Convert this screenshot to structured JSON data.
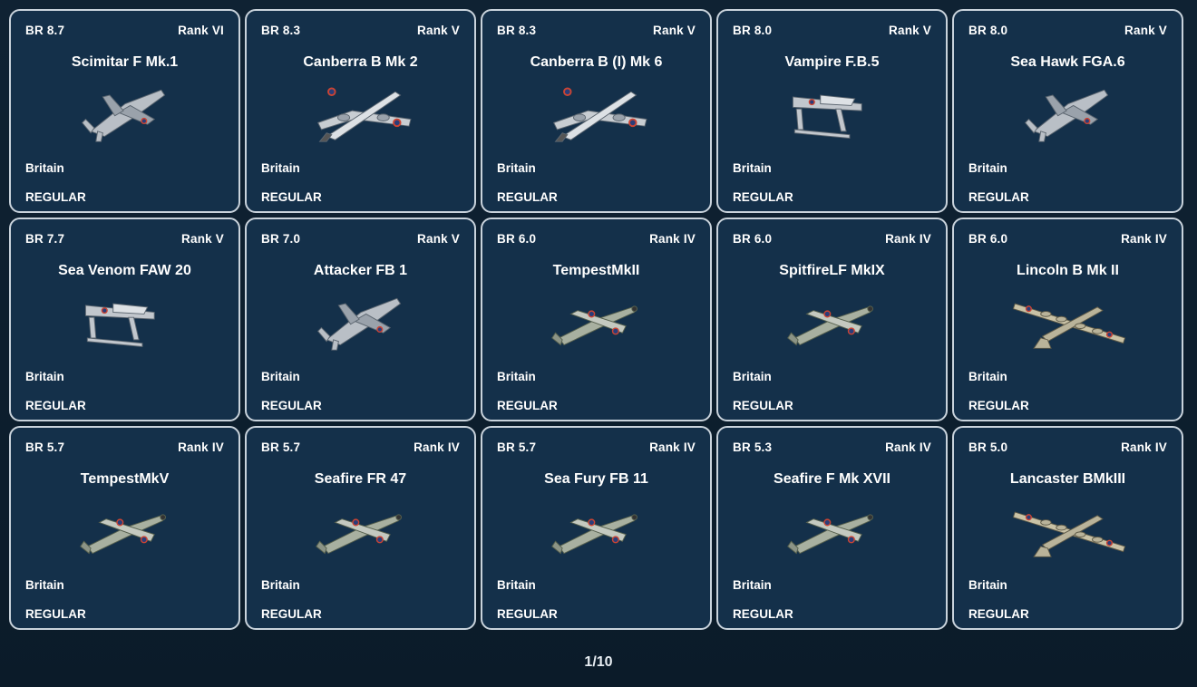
{
  "vehicles": [
    {
      "br": "BR 8.7",
      "rank": "Rank VI",
      "name": "Scimitar F Mk.1",
      "nation": "Britain",
      "status": "REGULAR",
      "icon": "jet-fighter-icon"
    },
    {
      "br": "BR 8.3",
      "rank": "Rank V",
      "name": "Canberra B Mk 2",
      "nation": "Britain",
      "status": "REGULAR",
      "icon": "jet-bomber-icon"
    },
    {
      "br": "BR 8.3",
      "rank": "Rank V",
      "name": "Canberra B (I) Mk 6",
      "nation": "Britain",
      "status": "REGULAR",
      "icon": "jet-bomber-icon"
    },
    {
      "br": "BR 8.0",
      "rank": "Rank V",
      "name": "Vampire F.B.5",
      "nation": "Britain",
      "status": "REGULAR",
      "icon": "twin-boom-jet-icon"
    },
    {
      "br": "BR 8.0",
      "rank": "Rank V",
      "name": "Sea Hawk FGA.6",
      "nation": "Britain",
      "status": "REGULAR",
      "icon": "jet-fighter-icon"
    },
    {
      "br": "BR 7.7",
      "rank": "Rank V",
      "name": "Sea Venom FAW 20",
      "nation": "Britain",
      "status": "REGULAR",
      "icon": "twin-boom-jet-icon"
    },
    {
      "br": "BR 7.0",
      "rank": "Rank V",
      "name": "Attacker FB 1",
      "nation": "Britain",
      "status": "REGULAR",
      "icon": "jet-fighter-icon"
    },
    {
      "br": "BR 6.0",
      "rank": "Rank IV",
      "name": "TempestMkII",
      "nation": "Britain",
      "status": "REGULAR",
      "icon": "prop-fighter-icon"
    },
    {
      "br": "BR 6.0",
      "rank": "Rank IV",
      "name": "SpitfireLF MkIX",
      "nation": "Britain",
      "status": "REGULAR",
      "icon": "prop-fighter-icon"
    },
    {
      "br": "BR 6.0",
      "rank": "Rank IV",
      "name": "Lincoln B Mk II",
      "nation": "Britain",
      "status": "REGULAR",
      "icon": "heavy-bomber-icon"
    },
    {
      "br": "BR 5.7",
      "rank": "Rank IV",
      "name": "TempestMkV",
      "nation": "Britain",
      "status": "REGULAR",
      "icon": "prop-fighter-icon"
    },
    {
      "br": "BR 5.7",
      "rank": "Rank IV",
      "name": "Seafire FR 47",
      "nation": "Britain",
      "status": "REGULAR",
      "icon": "prop-fighter-icon"
    },
    {
      "br": "BR 5.7",
      "rank": "Rank IV",
      "name": "Sea Fury FB 11",
      "nation": "Britain",
      "status": "REGULAR",
      "icon": "prop-fighter-icon"
    },
    {
      "br": "BR 5.3",
      "rank": "Rank IV",
      "name": "Seafire F Mk XVII",
      "nation": "Britain",
      "status": "REGULAR",
      "icon": "prop-fighter-icon"
    },
    {
      "br": "BR 5.0",
      "rank": "Rank IV",
      "name": "Lancaster BMkIII",
      "nation": "Britain",
      "status": "REGULAR",
      "icon": "heavy-bomber-icon"
    }
  ],
  "pagination": {
    "label": "1/10"
  },
  "colors": {
    "card_bg": "#14304a",
    "card_border": "#c9d3dc",
    "page_bg": "#0b1c2a",
    "text": "#ffffff"
  }
}
